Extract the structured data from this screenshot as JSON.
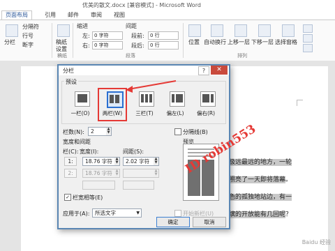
{
  "window": {
    "title": "优美的散文.docx [兼容模式] - Microsoft Word"
  },
  "ribbon": {
    "tabs": [
      "页面布局",
      "引用",
      "邮件",
      "审阅",
      "视图"
    ],
    "active_tab": "页面布局",
    "items": {
      "columns_label": "分栏",
      "breaks_label": "分隔符",
      "line_numbers_label": "行号",
      "hyphenation_label": "断字",
      "draft_label": "稿纸",
      "draft_label2": "设置",
      "indent_label": "缩进",
      "spacing_label": "间距",
      "indent_left_label": "左:",
      "indent_left_value": "0 字符",
      "indent_right_label": "右:",
      "indent_right_value": "0 字符",
      "spacing_before_label": "段前:",
      "spacing_before_value": "0 行",
      "spacing_after_label": "段后:",
      "spacing_after_value": "0 行",
      "position_label": "位置",
      "wrap_label": "自动换行",
      "bring_forward_label": "上移一层",
      "send_backward_label": "下移一层",
      "select_pane_label": "选择窗格"
    },
    "groups": {
      "draft": "稿纸",
      "paragraph": "段落",
      "arrange": "排列"
    }
  },
  "document": {
    "lines": [
      {
        "pre": "",
        "hl": "极远最远的地方，一轮",
        "post": ""
      },
      {
        "pre": "",
        "hl": "照亮了一天即将落幕",
        "post": "。"
      },
      {
        "pre": "",
        "hl": "色的孤独地站边，有一",
        "post": ""
      },
      {
        "pre": "",
        "hl": "缤的开放能有几回呢",
        "post": "？"
      }
    ]
  },
  "dialog": {
    "title": "分栏",
    "help_label": "?",
    "close_label": "✕",
    "presets_label": "预设",
    "presets": [
      {
        "label": "一栏(O)",
        "cols": 1
      },
      {
        "label": "两栏(W)",
        "cols": 2
      },
      {
        "label": "三栏(T)",
        "cols": 3
      },
      {
        "label": "偏左(L)",
        "cols": 2
      },
      {
        "label": "偏右(R)",
        "cols": 2
      }
    ],
    "selected_preset": "两栏(W)",
    "num_columns_label": "栏数(N):",
    "num_columns_value": "2",
    "line_between_label": "分隔线(B)",
    "width_spacing_label": "宽度和间距",
    "col_header": "栏(C):",
    "width_header": "宽度(I):",
    "spacing_header": "间距(S):",
    "preview_label": "预览",
    "rows": [
      {
        "num": "1:",
        "width": "18.76 字符",
        "spacing": "2.02 字符",
        "enabled": true
      },
      {
        "num": "2:",
        "width": "18.76 字符",
        "spacing": "",
        "enabled": false
      }
    ],
    "equal_width_label": "栏宽相等(E)",
    "equal_width_checked": true,
    "apply_to_label": "应用于(A):",
    "apply_to_value": "所选文字",
    "new_column_label": "开始新栏(U)",
    "ok_label": "确定",
    "cancel_label": "取消"
  },
  "annotations": {
    "watermark": "ID robin553",
    "bottom_mark": "Baidu 经验"
  },
  "colors": {
    "accent": "#2b579a",
    "annotation": "#e53935",
    "dialog_border": "#5a86b3"
  }
}
